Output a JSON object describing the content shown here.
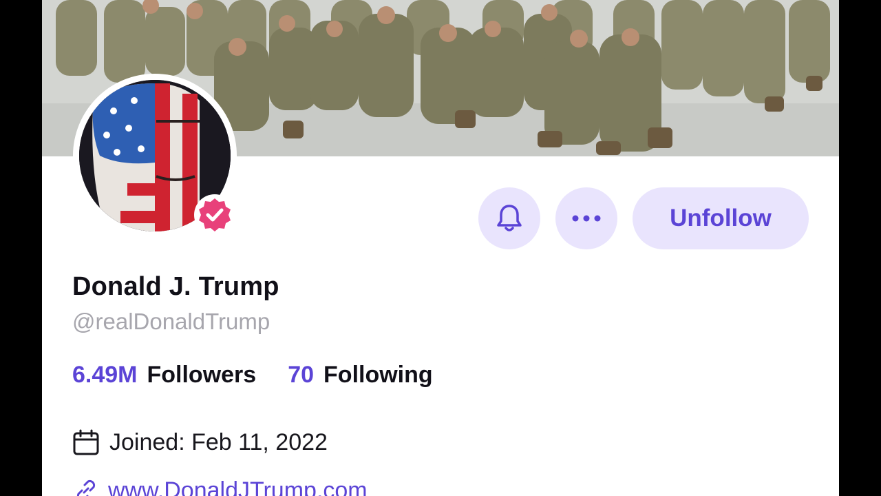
{
  "profile": {
    "display_name": "Donald J. Trump",
    "handle": "@realDonaldTrump",
    "followers_count": "6.49M",
    "followers_label": "Followers",
    "following_count": "70",
    "following_label": "Following",
    "joined": "Joined: Feb 11, 2022",
    "website": "www.DonaldJTrump.com",
    "verified": true
  },
  "actions": {
    "notifications_icon": "bell-icon",
    "more_icon": "ellipsis-icon",
    "unfollow_label": "Unfollow"
  },
  "colors": {
    "accent": "#5b44d6",
    "button_bg": "#e9e4fd",
    "verified_badge": "#e8417a",
    "text_primary": "#111018",
    "text_secondary": "#a7a6ad"
  }
}
